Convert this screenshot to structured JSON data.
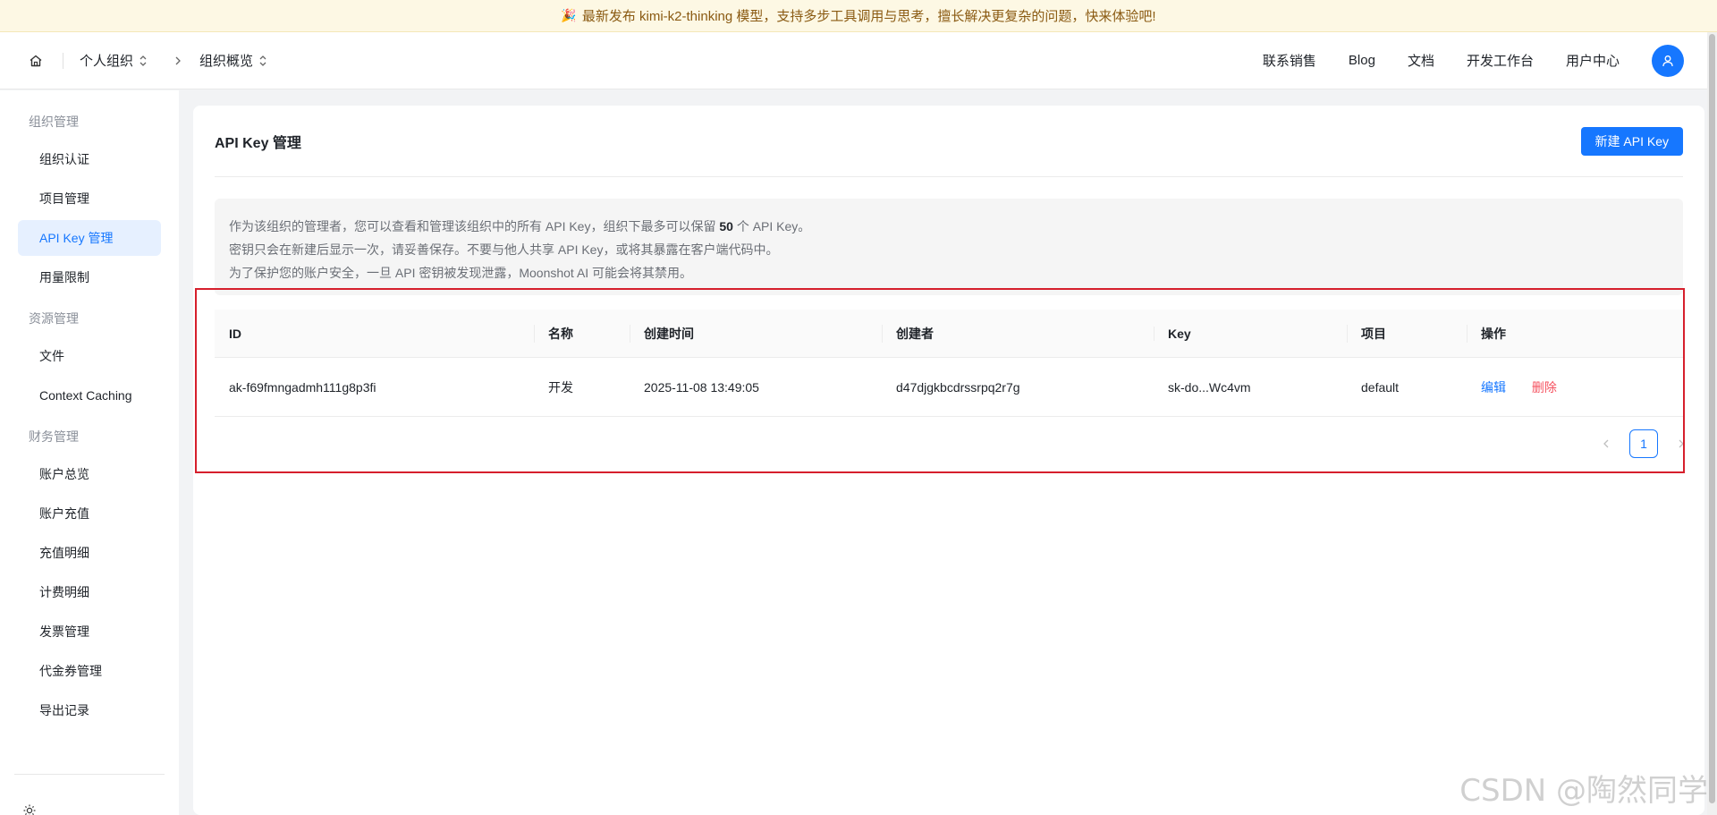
{
  "banner": {
    "text": "最新发布 kimi-k2-thinking 模型，支持多步工具调用与思考，擅长解决更复杂的问题，快来体验吧!"
  },
  "breadcrumb": {
    "org": "个人组织",
    "page": "组织概览"
  },
  "nav": {
    "sales": "联系销售",
    "blog": "Blog",
    "docs": "文档",
    "console": "开发工作台",
    "user_center": "用户中心"
  },
  "sidebar": {
    "groups": [
      {
        "label": "组织管理",
        "items": [
          "组织认证",
          "项目管理",
          "API Key 管理",
          "用量限制"
        ]
      },
      {
        "label": "资源管理",
        "items": [
          "文件",
          "Context Caching"
        ]
      },
      {
        "label": "财务管理",
        "items": [
          "账户总览",
          "账户充值",
          "充值明细",
          "计费明细",
          "发票管理",
          "代金券管理",
          "导出记录"
        ]
      }
    ],
    "active": "API Key 管理"
  },
  "main": {
    "title": "API Key 管理",
    "new_button": "新建 API Key",
    "notice": {
      "line1_prefix": "作为该组织的管理者，您可以查看和管理该组织中的所有 API Key，组织下最多可以保留 ",
      "line1_count": "50",
      "line1_suffix": " 个 API Key。",
      "line2": "密钥只会在新建后显示一次，请妥善保存。不要与他人共享 API Key，或将其暴露在客户端代码中。",
      "line3": "为了保护您的账户安全，一旦 API 密钥被发现泄露，Moonshot AI 可能会将其禁用。"
    },
    "table": {
      "headers": [
        "ID",
        "名称",
        "创建时间",
        "创建者",
        "Key",
        "项目",
        "操作"
      ],
      "rows": [
        {
          "id": "ak-f69fmngadmh111g8p3fi",
          "name": "开发",
          "created_at": "2025-11-08 13:49:05",
          "creator": "d47djgkbcdrssrpq2r7g",
          "key": "sk-do...Wc4vm",
          "project": "default",
          "edit": "编辑",
          "delete": "删除"
        }
      ]
    },
    "pagination": {
      "current": "1"
    }
  },
  "watermark": "CSDN @陶然同学"
}
